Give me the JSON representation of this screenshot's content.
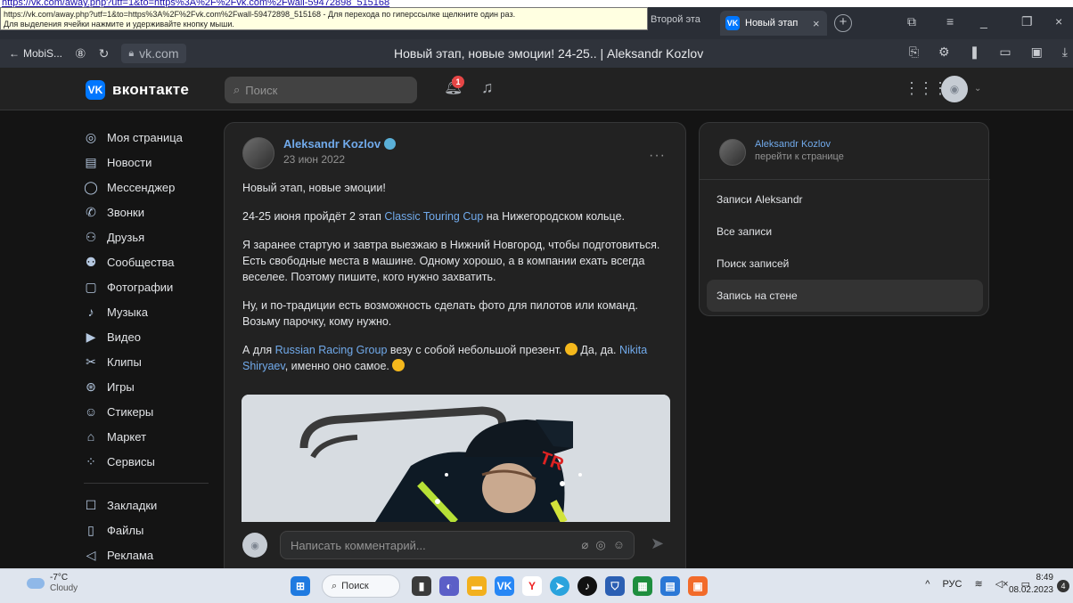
{
  "top_link": "https://vk.com/away.php?utf=1&to=https%3A%2F%2Fvk.com%2Fwall-59472898_515168",
  "tooltip": {
    "line1": "https://vk.com/away.php?utf=1&to=https%3A%2F%2Fvk.com%2Fwall-59472898_515168 - Для перехода по гиперссылке щелкните один раз.",
    "line2": "Для выделения ячейки нажмите и удерживайте кнопку мыши."
  },
  "browser": {
    "prev_tab": "Второй эта",
    "active_tab": "Новый этап",
    "back_label": "MobiS...",
    "domain": "vk.com",
    "page_title": "Новый этап, новые эмоции! 24-25.. | Aleksandr Kozlov"
  },
  "vk_header": {
    "logo": "вконтакте",
    "search_placeholder": "Поиск",
    "notif_count": "1"
  },
  "nav": {
    "items": [
      "Моя страница",
      "Новости",
      "Мессенджер",
      "Звонки",
      "Друзья",
      "Сообщества",
      "Фотографии",
      "Музыка",
      "Видео",
      "Клипы",
      "Игры",
      "Стикеры",
      "Маркет",
      "Сервисы"
    ],
    "icons": [
      "person-icon",
      "news-icon",
      "chat-icon",
      "phone-icon",
      "friends-icon",
      "groups-icon",
      "photos-icon",
      "music-icon",
      "video-icon",
      "clips-icon",
      "games-icon",
      "stickers-icon",
      "market-icon",
      "services-icon"
    ],
    "secondary": [
      "Закладки",
      "Файлы",
      "Реклама"
    ]
  },
  "post": {
    "author": "Aleksandr Kozlov",
    "date": "23 июн 2022",
    "p1": "Новый этап, новые эмоции!",
    "p2_a": "24-25 июня пройдёт 2 этап ",
    "p2_link": "Classic Touring Cup",
    "p2_b": " на Нижегородском кольце.",
    "p3": "Я заранее стартую и завтра выезжаю в Нижний Новгород, чтобы подготовиться. Есть свободные места в машине. Одному хорошо, а в компании ехать всегда веселее. Поэтому пишите, кого нужно захватить.",
    "p4": "Ну, и по-традиции есть возможность сделать фото для пилотов или команд. Возьму парочку, кому нужно.",
    "p5_a": "А для ",
    "p5_link1": "Russian Racing Group",
    "p5_b": " везу с собой небольшой презент. ",
    "p5_c": " Да, да. ",
    "p5_link2": "Nikita Shiryaev",
    "p5_d": ", именно оно самое. ",
    "comment_placeholder": "Написать комментарий..."
  },
  "right": {
    "name": "Aleksandr Kozlov",
    "sub": "перейти к странице",
    "items": [
      "Записи Aleksandr",
      "Все записи",
      "Поиск записей",
      "Запись на стене"
    ]
  },
  "taskbar": {
    "temp": "-7°C",
    "weather": "Cloudy",
    "search": "Поиск",
    "lang": "РУС",
    "time": "8:49",
    "date": "08.02.2023"
  }
}
